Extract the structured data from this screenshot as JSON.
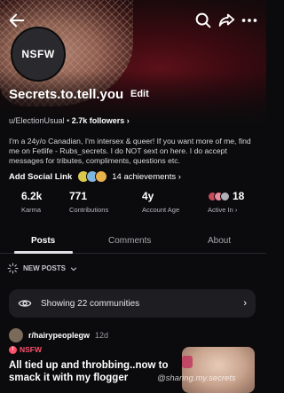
{
  "profile": {
    "avatar_text": "NSFW",
    "display_name": "Secrets.to.tell.you",
    "edit_label": "Edit",
    "username": "u/ElectionUsual",
    "followers": "2.7k followers",
    "bio": "I'm a 24y/o Canadian, I'm intersex & queer!  If you want more of me, find me on Fetlife - Rubs_secrets. I do NOT sext on here. I do accept messages for tributes, compliments, questions etc.",
    "add_social_link": "Add Social Link",
    "achievements": "14 achievements"
  },
  "stats": {
    "karma_value": "6.2k",
    "karma_label": "Karma",
    "contributions_value": "771",
    "contributions_label": "Contributions",
    "account_age_value": "4y",
    "account_age_label": "Account Age",
    "active_in_value": "18",
    "active_in_label": "Active In"
  },
  "tabs": [
    "Posts",
    "Comments",
    "About"
  ],
  "active_tab": "Posts",
  "feed": {
    "sort_label": "NEW POSTS",
    "communities_label": "Showing 22 communities"
  },
  "post": {
    "subreddit": "r/hairypeoplegw",
    "time": "12d",
    "nsfw_label": "NSFW",
    "title": "All tied up and throbbing..now to smack it with my flogger"
  },
  "watermark": "@sharing.my.secrets",
  "colors": {
    "accent_nsfw": "#ff4f6d",
    "background": "#0b0b0d",
    "card": "#1d1d22"
  },
  "icons": [
    "back-arrow-icon",
    "search-icon",
    "share-icon",
    "more-icon",
    "chevron-right-icon",
    "chevron-down-icon",
    "eye-icon",
    "sparkle-icon"
  ]
}
